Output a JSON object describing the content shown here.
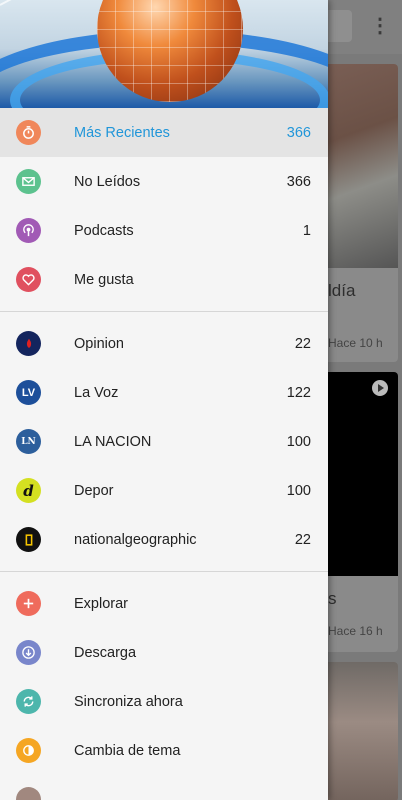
{
  "background": {
    "more_icon": "⋮",
    "cards": [
      {
        "title": "ldía",
        "meta": "Hace 10 h"
      },
      {
        "title": "s",
        "meta": "Hace 16 h"
      },
      {
        "title": "",
        "meta": ""
      }
    ]
  },
  "drawer": {
    "smart_items": [
      {
        "label": "Más Recientes",
        "count": "366",
        "icon": "timer-icon",
        "color": "#f0875a",
        "active": true
      },
      {
        "label": "No Leídos",
        "count": "366",
        "icon": "mail-icon",
        "color": "#5cc28e",
        "active": false
      },
      {
        "label": "Podcasts",
        "count": "1",
        "icon": "podcast-icon",
        "color": "#a15ab5",
        "active": false
      },
      {
        "label": "Me gusta",
        "count": "",
        "icon": "heart-icon",
        "color": "#e0505f",
        "active": false
      }
    ],
    "feeds": [
      {
        "label": "Opinion",
        "count": "22",
        "logo_text": "",
        "logo": "opinion-logo"
      },
      {
        "label": "La Voz",
        "count": "122",
        "logo_text": "LV",
        "logo": "la-voz-logo"
      },
      {
        "label": "LA NACION",
        "count": "100",
        "logo_text": "LN",
        "logo": "la-nacion-logo"
      },
      {
        "label": "Depor",
        "count": "100",
        "logo_text": "d",
        "logo": "depor-logo"
      },
      {
        "label": "nationalgeographic",
        "count": "22",
        "logo_text": "",
        "logo": "natgeo-logo"
      }
    ],
    "actions": [
      {
        "label": "Explorar",
        "icon": "plus-icon",
        "color": "#ef6b5c"
      },
      {
        "label": "Descarga",
        "icon": "download-icon",
        "color": "#7986cb"
      },
      {
        "label": "Sincroniza ahora",
        "icon": "sync-icon",
        "color": "#4db6ac"
      },
      {
        "label": "Cambia de tema",
        "icon": "theme-icon",
        "color": "#f5a623"
      }
    ]
  }
}
